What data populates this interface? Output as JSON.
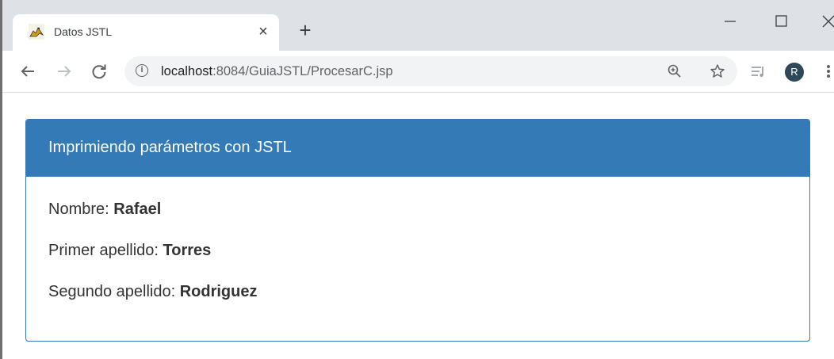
{
  "browser": {
    "tab": {
      "title": "Datos JSTL",
      "favicon": "tomcat-icon"
    },
    "url": {
      "host": "localhost",
      "path": ":8084/GuiaJSTL/ProcesarC.jsp"
    },
    "profile_initial": "R"
  },
  "panel": {
    "heading": "Imprimiendo parámetros con JSTL",
    "rows": [
      {
        "label": "Nombre:",
        "value": "Rafael"
      },
      {
        "label": "Primer apellido:",
        "value": "Torres"
      },
      {
        "label": "Segundo apellido:",
        "value": "Rodriguez"
      }
    ],
    "accent": "#337ab7"
  }
}
